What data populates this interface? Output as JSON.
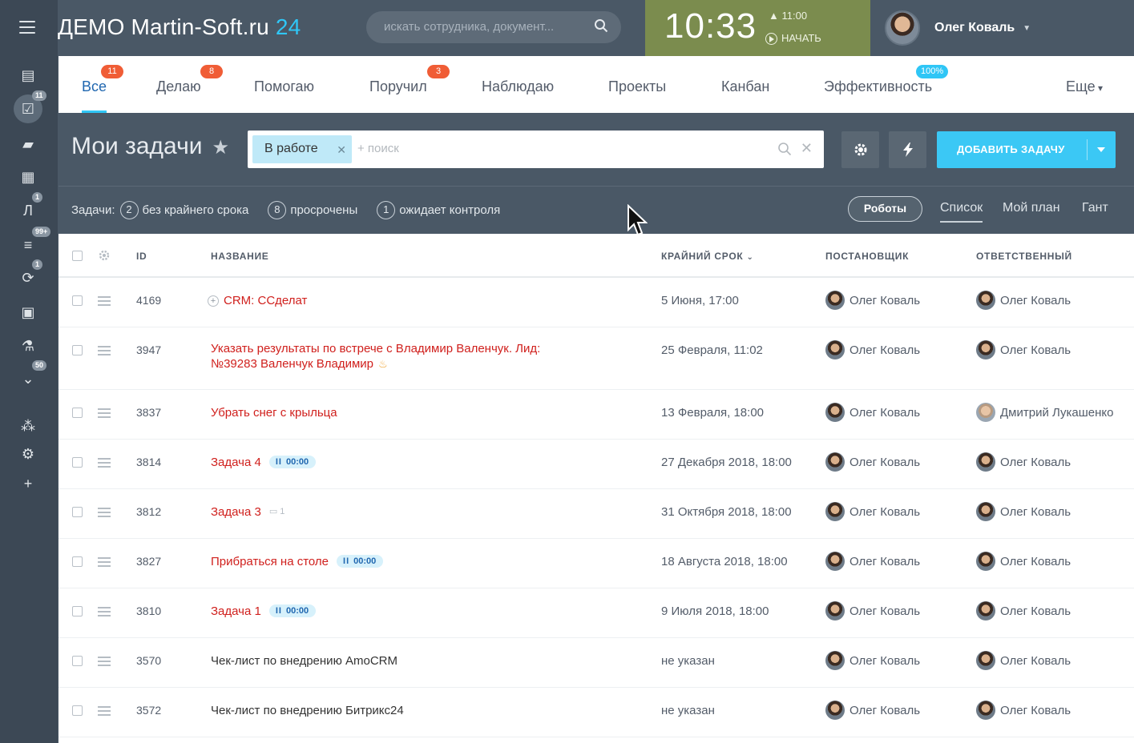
{
  "header": {
    "logo_text": "ДЕМО Martin-Soft.ru",
    "logo_num": "24",
    "search_placeholder": "искать сотрудника, документ...",
    "clock_time": "10:33",
    "alarm_time": "11:00",
    "start_label": "НАЧАТЬ",
    "user_name": "Олег Коваль"
  },
  "sidebar": {
    "items": [
      {
        "icon": "feed-icon",
        "glyph": "▤",
        "badge": ""
      },
      {
        "icon": "tasks-icon",
        "glyph": "☑",
        "badge": "11"
      },
      {
        "icon": "chat-icon",
        "glyph": "▰",
        "badge": ""
      },
      {
        "icon": "calendar-icon",
        "glyph": "▦",
        "badge": ""
      },
      {
        "icon": "leads-icon",
        "glyph": "Л",
        "badge": "1"
      },
      {
        "icon": "filter-icon",
        "glyph": "≡",
        "badge": "99+"
      },
      {
        "icon": "sync-icon",
        "glyph": "⟳",
        "badge": "1"
      },
      {
        "icon": "contacts-icon",
        "glyph": "▣",
        "badge": ""
      },
      {
        "icon": "flask-icon",
        "glyph": "⚗",
        "badge": ""
      },
      {
        "icon": "more-icon",
        "glyph": "⌄",
        "badge": "50"
      },
      {
        "icon": "structure-icon",
        "glyph": "⁂",
        "badge": ""
      },
      {
        "icon": "settings-icon",
        "glyph": "⚙",
        "badge": ""
      },
      {
        "icon": "add-icon",
        "glyph": "+",
        "badge": ""
      }
    ]
  },
  "tabs": [
    {
      "label": "Все",
      "badge": "11"
    },
    {
      "label": "Делаю",
      "badge": "8"
    },
    {
      "label": "Помогаю",
      "badge": ""
    },
    {
      "label": "Поручил",
      "badge": "3"
    },
    {
      "label": "Наблюдаю",
      "badge": ""
    },
    {
      "label": "Проекты",
      "badge": ""
    },
    {
      "label": "Канбан",
      "badge": ""
    },
    {
      "label": "Эффективность",
      "badge": "100%"
    },
    {
      "label": "Еще",
      "badge": ""
    }
  ],
  "toolbar": {
    "title": "Мои задачи",
    "filter_chip": "В работе",
    "filter_placeholder": "+ поиск",
    "add_button": "ДОБАВИТЬ ЗАДАЧУ"
  },
  "counters": {
    "lead": "Задачи:",
    "items": [
      {
        "count": "2",
        "label": "без крайнего срока"
      },
      {
        "count": "8",
        "label": "просрочены"
      },
      {
        "count": "1",
        "label": "ожидает контроля"
      }
    ],
    "robots": "Роботы",
    "views": [
      "Список",
      "Мой план",
      "Гант"
    ]
  },
  "table": {
    "headers": {
      "id": "ID",
      "name": "НАЗВАНИЕ",
      "deadline": "КРАЙНИЙ СРОК",
      "creator": "ПОСТАНОВЩИК",
      "responsible": "ОТВЕТСТВЕННЫЙ"
    },
    "rows": [
      {
        "id": "4169",
        "title": "CRM: ССделат",
        "title2": "",
        "deadline": "5 Июня, 17:00",
        "creator": "Олег Коваль",
        "responsible": "Олег Коваль",
        "timer": "",
        "comments": ""
      },
      {
        "id": "3947",
        "title": "Указать результаты по встрече с Владимир Валенчук. Лид:",
        "title2": "№39283 Валенчук Владимир",
        "deadline": "25 Февраля, 11:02",
        "creator": "Олег Коваль",
        "responsible": "Олег Коваль",
        "timer": "",
        "comments": ""
      },
      {
        "id": "3837",
        "title": "Убрать снег с крыльца",
        "title2": "",
        "deadline": "13 Февраля, 18:00",
        "creator": "Олег Коваль",
        "responsible": "Дмитрий Лукашенко",
        "timer": "",
        "comments": ""
      },
      {
        "id": "3814",
        "title": "Задача 4",
        "title2": "",
        "deadline": "27 Декабря 2018, 18:00",
        "creator": "Олег Коваль",
        "responsible": "Олег Коваль",
        "timer": "00:00",
        "comments": ""
      },
      {
        "id": "3812",
        "title": "Задача 3",
        "title2": "",
        "deadline": "31 Октября 2018, 18:00",
        "creator": "Олег Коваль",
        "responsible": "Олег Коваль",
        "timer": "",
        "comments": "1"
      },
      {
        "id": "3827",
        "title": "Прибраться на столе",
        "title2": "",
        "deadline": "18 Августа 2018, 18:00",
        "creator": "Олег Коваль",
        "responsible": "Олег Коваль",
        "timer": "00:00",
        "comments": ""
      },
      {
        "id": "3810",
        "title": "Задача 1",
        "title2": "",
        "deadline": "9 Июля 2018, 18:00",
        "creator": "Олег Коваль",
        "responsible": "Олег Коваль",
        "timer": "00:00",
        "comments": ""
      },
      {
        "id": "3570",
        "title": "Чек-лист по внедрению AmoCRM",
        "title2": "",
        "deadline": "не указан",
        "creator": "Олег Коваль",
        "responsible": "Олег Коваль",
        "timer": "",
        "comments": ""
      },
      {
        "id": "3572",
        "title": "Чек-лист по внедрению Битрикс24",
        "title2": "",
        "deadline": "не указан",
        "creator": "Олег Коваль",
        "responsible": "Олег Коваль",
        "timer": "",
        "comments": ""
      }
    ]
  }
}
